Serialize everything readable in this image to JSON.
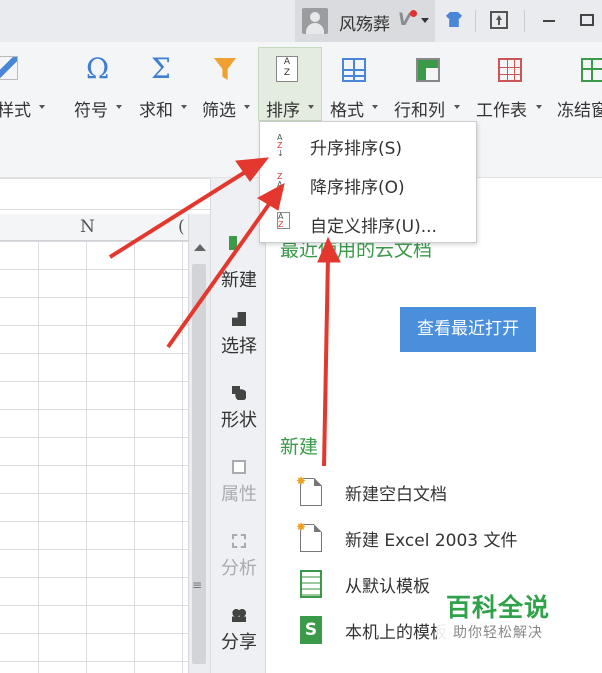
{
  "titlebar": {
    "username": "风殇葬",
    "vip_badge": "V"
  },
  "ribbon": {
    "buttons": [
      {
        "label": "样式",
        "icon": "cell-style-icon"
      },
      {
        "label": "符号",
        "icon": "omega-symbol-icon"
      },
      {
        "label": "求和",
        "icon": "sigma-sum-icon"
      },
      {
        "label": "筛选",
        "icon": "filter-funnel-icon"
      },
      {
        "label": "排序",
        "icon": "sort-icon",
        "active": true
      },
      {
        "label": "格式",
        "icon": "format-grid-icon"
      },
      {
        "label": "行和列",
        "icon": "rows-columns-icon"
      },
      {
        "label": "工作表",
        "icon": "worksheet-icon"
      },
      {
        "label": "冻结窗",
        "icon": "freeze-panes-icon"
      }
    ],
    "symbols": {
      "omega": "Ω",
      "sigma": "Σ"
    }
  },
  "sort_menu": {
    "items": [
      {
        "label": "升序排序(S)",
        "icon": "ascending-sort-icon",
        "glyph_top": "A",
        "glyph_bottom": "Z"
      },
      {
        "label": "降序排序(O)",
        "icon": "descending-sort-icon",
        "glyph_top": "Z",
        "glyph_bottom": "A"
      },
      {
        "label": "自定义排序(U)...",
        "icon": "custom-sort-icon",
        "glyph_top": "A",
        "glyph_bottom": "Z"
      }
    ]
  },
  "sheet": {
    "columns": [
      "N",
      "("
    ]
  },
  "side_toolbar": {
    "items": [
      {
        "label": "新建",
        "enabled": true
      },
      {
        "label": "选择",
        "enabled": true
      },
      {
        "label": "形状",
        "enabled": true
      },
      {
        "label": "属性",
        "enabled": false
      },
      {
        "label": "分析",
        "enabled": false
      },
      {
        "label": "分享",
        "enabled": true
      }
    ],
    "grip": "≡"
  },
  "start_pane": {
    "recent_heading": "最近使用的云文档",
    "recent_button": "查看最近打开",
    "new_heading": "新建",
    "new_items": [
      {
        "label": "新建空白文档",
        "icon": "blank-document-icon"
      },
      {
        "label": "新建 Excel 2003 文件",
        "icon": "excel-2003-document-icon"
      },
      {
        "label": "从默认模板",
        "icon": "template-icon"
      },
      {
        "label": "本机上的模板",
        "icon": "local-template-icon"
      }
    ]
  },
  "watermark": {
    "title": "百科全说",
    "subtitle": "助你轻松解决"
  },
  "colors": {
    "accent_green": "#3a9a4a",
    "button_blue": "#4a8fdc",
    "arrow_red": "#e4382f"
  }
}
